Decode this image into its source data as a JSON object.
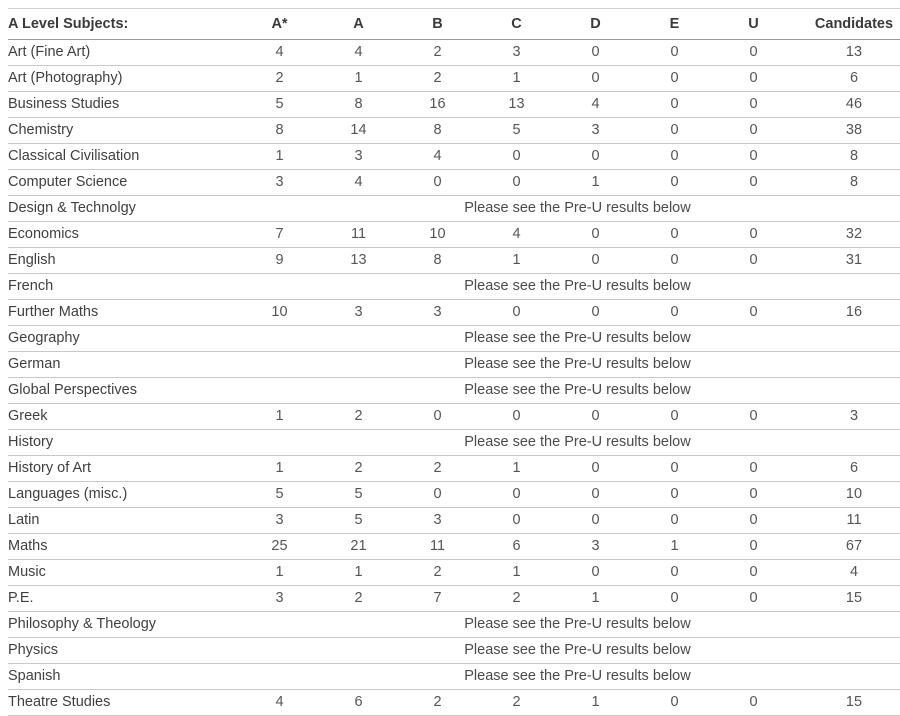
{
  "table": {
    "columns": [
      {
        "key": "subject",
        "label": "A Level Subjects:",
        "align": "left"
      },
      {
        "key": "astar",
        "label": "A*",
        "align": "center"
      },
      {
        "key": "a",
        "label": "A",
        "align": "center"
      },
      {
        "key": "b",
        "label": "B",
        "align": "center"
      },
      {
        "key": "c",
        "label": "C",
        "align": "center"
      },
      {
        "key": "d",
        "label": "D",
        "align": "center"
      },
      {
        "key": "e",
        "label": "E",
        "align": "center"
      },
      {
        "key": "u",
        "label": "U",
        "align": "center"
      },
      {
        "key": "candidates",
        "label": "Candidates",
        "align": "center"
      }
    ],
    "note_text": "Please see the Pre-U results below",
    "rows": [
      {
        "subject": "Art (Fine Art)",
        "note": false,
        "values": [
          "4",
          "4",
          "2",
          "3",
          "0",
          "0",
          "0",
          "13"
        ]
      },
      {
        "subject": "Art (Photography)",
        "note": false,
        "values": [
          "2",
          "1",
          "2",
          "1",
          "0",
          "0",
          "0",
          "6"
        ]
      },
      {
        "subject": "Business Studies",
        "note": false,
        "values": [
          "5",
          "8",
          "16",
          "13",
          "4",
          "0",
          "0",
          "46"
        ]
      },
      {
        "subject": "Chemistry",
        "note": false,
        "values": [
          "8",
          "14",
          "8",
          "5",
          "3",
          "0",
          "0",
          "38"
        ]
      },
      {
        "subject": "Classical Civilisation",
        "note": false,
        "values": [
          "1",
          "3",
          "4",
          "0",
          "0",
          "0",
          "0",
          "8"
        ]
      },
      {
        "subject": "Computer Science",
        "note": false,
        "values": [
          "3",
          "4",
          "0",
          "0",
          "1",
          "0",
          "0",
          "8"
        ]
      },
      {
        "subject": "Design & Technolgy",
        "note": true,
        "values": []
      },
      {
        "subject": "Economics",
        "note": false,
        "values": [
          "7",
          "11",
          "10",
          "4",
          "0",
          "0",
          "0",
          "32"
        ]
      },
      {
        "subject": "English",
        "note": false,
        "values": [
          "9",
          "13",
          "8",
          "1",
          "0",
          "0",
          "0",
          "31"
        ]
      },
      {
        "subject": "French",
        "note": true,
        "values": []
      },
      {
        "subject": "Further Maths",
        "note": false,
        "values": [
          "10",
          "3",
          "3",
          "0",
          "0",
          "0",
          "0",
          "16"
        ]
      },
      {
        "subject": "Geography",
        "note": true,
        "values": []
      },
      {
        "subject": "German",
        "note": true,
        "values": []
      },
      {
        "subject": "Global Perspectives",
        "note": true,
        "values": []
      },
      {
        "subject": "Greek",
        "note": false,
        "values": [
          "1",
          "2",
          "0",
          "0",
          "0",
          "0",
          "0",
          "3"
        ]
      },
      {
        "subject": "History",
        "note": true,
        "values": []
      },
      {
        "subject": "History of Art",
        "note": false,
        "values": [
          "1",
          "2",
          "2",
          "1",
          "0",
          "0",
          "0",
          "6"
        ]
      },
      {
        "subject": "Languages (misc.)",
        "note": false,
        "values": [
          "5",
          "5",
          "0",
          "0",
          "0",
          "0",
          "0",
          "10"
        ]
      },
      {
        "subject": "Latin",
        "note": false,
        "values": [
          "3",
          "5",
          "3",
          "0",
          "0",
          "0",
          "0",
          "11"
        ]
      },
      {
        "subject": "Maths",
        "note": false,
        "values": [
          "25",
          "21",
          "11",
          "6",
          "3",
          "1",
          "0",
          "67"
        ]
      },
      {
        "subject": "Music",
        "note": false,
        "values": [
          "1",
          "1",
          "2",
          "1",
          "0",
          "0",
          "0",
          "4"
        ]
      },
      {
        "subject": "P.E.",
        "note": false,
        "values": [
          "3",
          "2",
          "7",
          "2",
          "1",
          "0",
          "0",
          "15"
        ]
      },
      {
        "subject": "Philosophy & Theology",
        "note": true,
        "values": []
      },
      {
        "subject": "Physics",
        "note": true,
        "values": []
      },
      {
        "subject": "Spanish",
        "note": true,
        "values": []
      },
      {
        "subject": "Theatre Studies",
        "note": false,
        "values": [
          "4",
          "6",
          "2",
          "2",
          "1",
          "0",
          "0",
          "15"
        ]
      }
    ]
  },
  "colors": {
    "text": "#3f3f3f",
    "value_text": "#555555",
    "header_text": "#3a3a3a",
    "border": "#c9c9c9",
    "header_border": "#9b9b9b",
    "background": "#ffffff"
  }
}
